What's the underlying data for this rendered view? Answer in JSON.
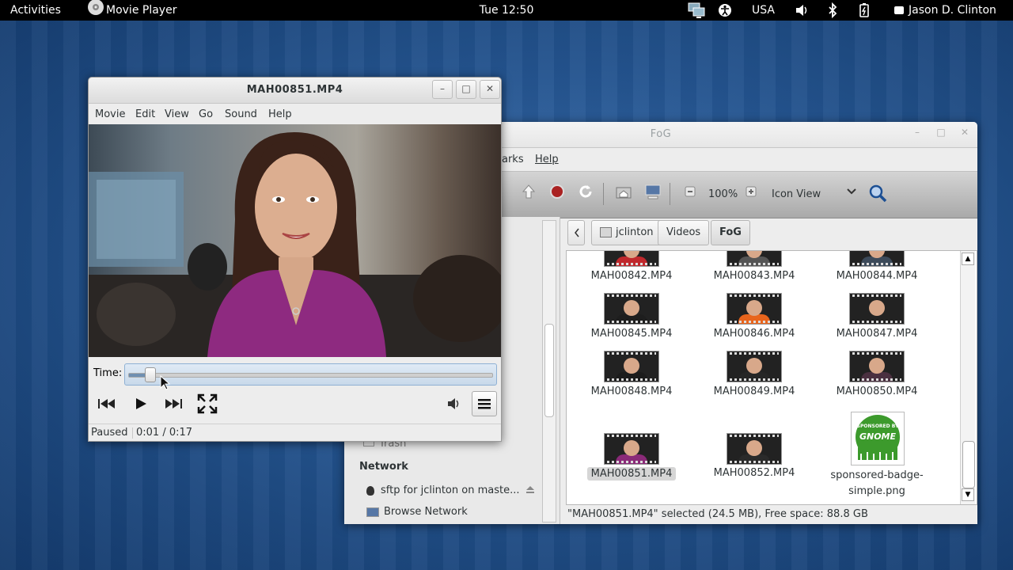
{
  "topbar": {
    "activities": "Activities",
    "app_name": "Movie Player",
    "clock": "Tue 12:50",
    "keyboard_layout": "USA",
    "user": "Jason D. Clinton"
  },
  "player": {
    "title": "MAH00851.MP4",
    "menus": [
      "Movie",
      "Edit",
      "View",
      "Go",
      "Sound",
      "Help"
    ],
    "time_label": "Time:",
    "seek_fraction": 0.059,
    "status": "Paused",
    "time": "0:01 / 0:17"
  },
  "files": {
    "title": "FoG",
    "menus": [
      "arks",
      "Help"
    ],
    "zoom": "100%",
    "view_mode": "Icon View",
    "path": [
      "jclinton",
      "Videos",
      "FoG"
    ],
    "sidebar": {
      "trash": "Trash",
      "network_heading": "Network",
      "sftp": "sftp for jclinton on maste...",
      "browse_network": "Browse Network"
    },
    "items": [
      {
        "name": "MAH00842.MP4",
        "shirt": "#c0282c"
      },
      {
        "name": "MAH00843.MP4",
        "shirt": "#555555"
      },
      {
        "name": "MAH00844.MP4",
        "shirt": "#3c4a5a"
      },
      {
        "name": "MAH00845.MP4",
        "shirt": "#1e1e1e"
      },
      {
        "name": "MAH00846.MP4",
        "shirt": "#e8641c"
      },
      {
        "name": "MAH00847.MP4",
        "shirt": "#222222"
      },
      {
        "name": "MAH00848.MP4",
        "shirt": "#1c1c1c"
      },
      {
        "name": "MAH00849.MP4",
        "shirt": "#262626"
      },
      {
        "name": "MAH00850.MP4",
        "shirt": "#4a3040"
      },
      {
        "name": "MAH00851.MP4",
        "shirt": "#8a2a78"
      },
      {
        "name": "MAH00852.MP4",
        "shirt": "#2a2a2a"
      },
      {
        "name_line1": "sponsored-badge-",
        "name_line2": "simple.png"
      }
    ],
    "badge_text_top": "SPONSORED BY",
    "badge_text_main": "GNOME",
    "status": "\"MAH00851.MP4\" selected (24.5 MB), Free space: 88.8 GB"
  },
  "colors": {
    "gnome_green": "#3c9a2c",
    "selection": "#d6d6d6"
  }
}
